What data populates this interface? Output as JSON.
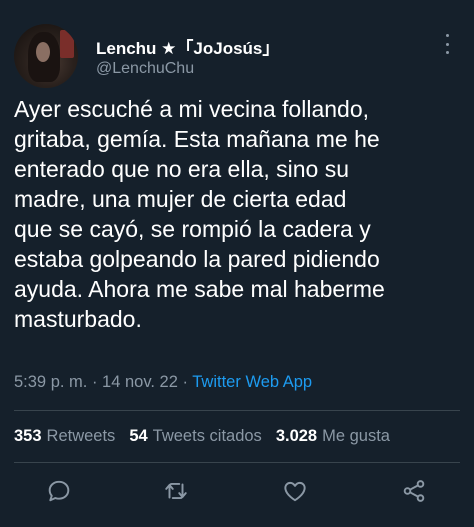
{
  "author": {
    "display_name": "Lenchu ★「JoJosús」",
    "handle": "@LenchuChu"
  },
  "tweet": {
    "text": "Ayer escuché a mi vecina follando,\ngritaba, gemía. Esta mañana me he\nenterado que no era ella, sino su\nmadre, una mujer de cierta edad\nque se cayó, se rompió la cadera y\nestaba golpeando la pared pidiendo\nayuda. Ahora me sabe mal haberme\nmasturbado.",
    "time": "5:39 p. m.",
    "separator": " · ",
    "date": "14 nov. 22",
    "source": "Twitter Web App"
  },
  "stats": {
    "retweets_count": "353",
    "retweets_label": "Retweets",
    "quotes_count": "54",
    "quotes_label": "Tweets citados",
    "likes_count": "3.028",
    "likes_label": "Me gusta"
  },
  "icons": {
    "reply": "reply-icon",
    "retweet": "retweet-icon",
    "like": "heart-icon",
    "share": "share-icon",
    "more": "more-icon"
  },
  "colors": {
    "background": "#15202b",
    "text": "#ffffff",
    "secondary": "#8b98a5",
    "link": "#1d9bf0",
    "divider": "#38444d"
  }
}
